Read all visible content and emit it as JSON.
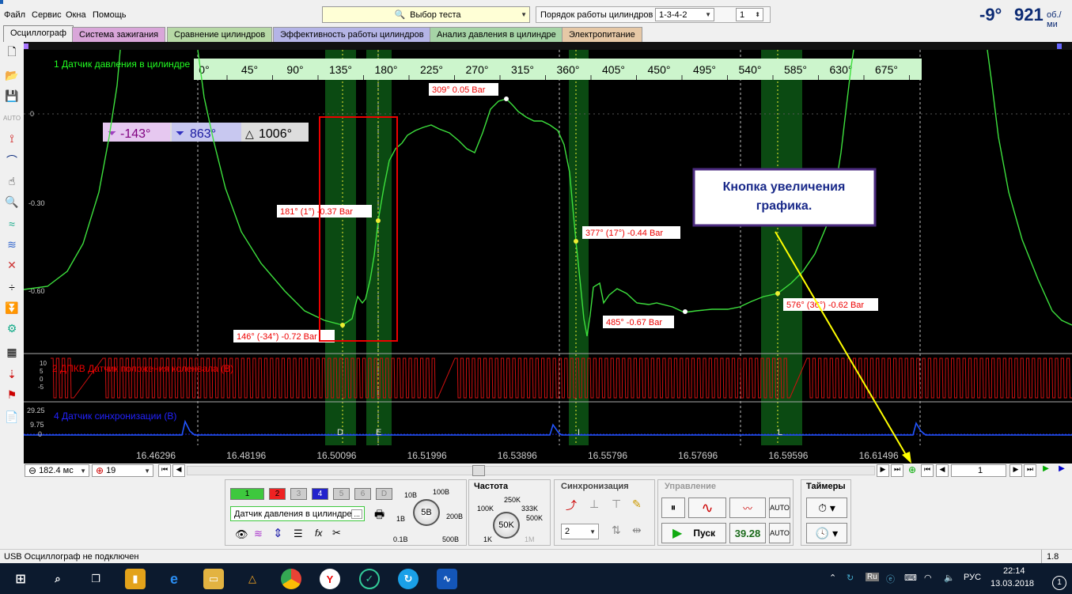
{
  "menu": {
    "items": [
      "Файл",
      "Сервис",
      "Окна",
      "Помощь"
    ]
  },
  "toolbar": {
    "test_select": "Выбор теста",
    "cyl_order_label": "Порядок работы цилиндров",
    "cyl_order_value": "1-3-4-2",
    "cyl_num": "1",
    "angle_value": "-9°",
    "rpm_value": "921",
    "rpm_unit": "об./ми"
  },
  "tabs": [
    {
      "label": "Осциллограф",
      "color": "#f0f0f0"
    },
    {
      "label": "Система зажигания",
      "color": "#d9a6d9"
    },
    {
      "label": "Сравнение цилиндров",
      "color": "#b7d9a6"
    },
    {
      "label": "Эффективность работы цилиндров",
      "color": "#b4b4e6"
    },
    {
      "label": "Анализ давления в цилиндре",
      "color": "#a6d4a6"
    },
    {
      "label": "Электропитание",
      "color": "#e6c8a6"
    }
  ],
  "scope": {
    "ch1_title": "1 Датчик давления в цилиндре",
    "ch2_title": "2 ДПКВ Датчик положения коленвала (В)",
    "ch4_title": "4 Датчик синхронизации (В)",
    "degree_ticks": [
      "0°",
      "45°",
      "90°",
      "135°",
      "180°",
      "225°",
      "270°",
      "315°",
      "360°",
      "405°",
      "450°",
      "495°",
      "540°",
      "585°",
      "630°",
      "675°"
    ],
    "y_ticks_ch1": [
      "0",
      "-0.30",
      "-0.60"
    ],
    "y_ticks_ch2": [
      "10",
      "5",
      "0",
      "-5"
    ],
    "y_ticks_ch4": [
      "29.25",
      "9.75",
      "0"
    ],
    "cursor_a": "-143°",
    "cursor_b": "863°",
    "cursor_delta": "1006°",
    "annotations": [
      "309° 0.05 Bar",
      "181° (1°) -0.37 Bar",
      "377° (17°) -0.44 Bar",
      "146° (-34°) -0.72 Bar",
      "485° -0.67 Bar",
      "576° (36°) -0.62 Bar"
    ],
    "callout": "Кнопка увеличения графика.",
    "markers": [
      "D",
      "E",
      "I",
      "L"
    ],
    "time_ticks": [
      "16.46296",
      "16.48196",
      "16.50096",
      "16.51996",
      "16.53896",
      "16.55796",
      "16.57696",
      "16.59596",
      "16.61496"
    ]
  },
  "hbar": {
    "timebase": "182.4 мс",
    "channel": "19",
    "page": "1"
  },
  "controls": {
    "channels": [
      "1",
      "2",
      "3",
      "4",
      "5",
      "6",
      "D"
    ],
    "sensor": "Датчик давления в цилиндре",
    "dots": "...",
    "voltage_ticks": [
      "10В",
      "100В",
      "1В",
      "200В",
      "0.1В",
      "500В"
    ],
    "voltage_value": "5В",
    "freq_title": "Частота",
    "freq_ticks": [
      "250K",
      "100K",
      "333K",
      "500K",
      "1K",
      "1M"
    ],
    "freq_value": "50K",
    "sync_title": "Синхронизация",
    "sync_value": "2",
    "control_title": "Управление",
    "start_label": "Пуск",
    "fps_value": "39.28",
    "auto_label": "AUTO",
    "timers_title": "Таймеры"
  },
  "status": {
    "text": "USB Осциллограф не подключен",
    "version": "1.8"
  },
  "taskbar": {
    "lang": "РУС",
    "time": "22:14",
    "date": "13.03.2018",
    "tray_ru": "Ru",
    "notif": "1"
  }
}
